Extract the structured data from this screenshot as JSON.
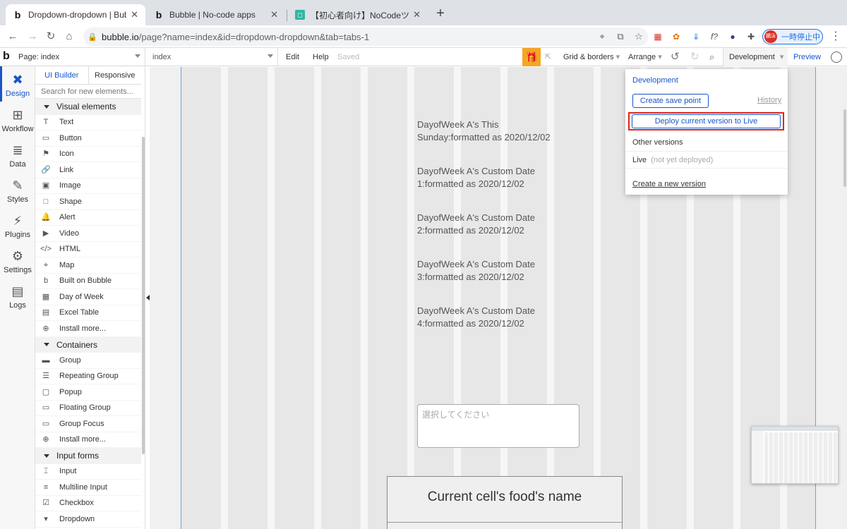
{
  "browser": {
    "tabs": [
      {
        "title": "Dropdown-dropdown | Bubble",
        "favicon": "b",
        "active": true
      },
      {
        "title": "Bubble | No-code apps",
        "favicon": "b",
        "active": false
      },
      {
        "title": "【初心者向け】NoCodeツールBu",
        "favicon": "teal-square",
        "active": false
      }
    ],
    "new_tab": "+",
    "close_glyph": "✕",
    "url_domain": "bubble.io",
    "url_path": "/page?name=index&id=dropdown-dropdown&tab=tabs-1",
    "pause_label": "一時停止中",
    "avatar_text": "鵬泳"
  },
  "topbar": {
    "logo": "b",
    "page_label": "Page: index",
    "element_selector": "index",
    "edit": "Edit",
    "help": "Help",
    "saved": "Saved",
    "grid_borders": "Grid & borders",
    "arrange": "Arrange",
    "environment": "Development",
    "preview": "Preview"
  },
  "rail": [
    {
      "label": "Design",
      "icon": "design-icon",
      "active": true
    },
    {
      "label": "Workflow",
      "icon": "workflow-icon"
    },
    {
      "label": "Data",
      "icon": "database-icon"
    },
    {
      "label": "Styles",
      "icon": "brush-icon"
    },
    {
      "label": "Plugins",
      "icon": "plug-icon"
    },
    {
      "label": "Settings",
      "icon": "gear-icon"
    },
    {
      "label": "Logs",
      "icon": "document-icon"
    }
  ],
  "palette": {
    "tabs": [
      "UI Builder",
      "Responsive"
    ],
    "search_placeholder": "Search for new elements...",
    "sections": [
      {
        "title": "Visual elements",
        "items": [
          {
            "label": "Text",
            "icon": "T"
          },
          {
            "label": "Button",
            "icon": "▭"
          },
          {
            "label": "Icon",
            "icon": "⚑"
          },
          {
            "label": "Link",
            "icon": "🔗"
          },
          {
            "label": "Image",
            "icon": "▣"
          },
          {
            "label": "Shape",
            "icon": "□"
          },
          {
            "label": "Alert",
            "icon": "🔔"
          },
          {
            "label": "Video",
            "icon": "▶"
          },
          {
            "label": "HTML",
            "icon": "</>"
          },
          {
            "label": "Map",
            "icon": "⌖"
          },
          {
            "label": "Built on Bubble",
            "icon": "b"
          },
          {
            "label": "Day of Week",
            "icon": "▦"
          },
          {
            "label": "Excel Table",
            "icon": "▤"
          },
          {
            "label": "Install more...",
            "icon": "⊕"
          }
        ]
      },
      {
        "title": "Containers",
        "items": [
          {
            "label": "Group",
            "icon": "▬"
          },
          {
            "label": "Repeating Group",
            "icon": "☰"
          },
          {
            "label": "Popup",
            "icon": "▢"
          },
          {
            "label": "Floating Group",
            "icon": "▭"
          },
          {
            "label": "Group Focus",
            "icon": "▭"
          },
          {
            "label": "Install more...",
            "icon": "⊕"
          }
        ]
      },
      {
        "title": "Input forms",
        "items": [
          {
            "label": "Input",
            "icon": "⌶"
          },
          {
            "label": "Multiline Input",
            "icon": "≡"
          },
          {
            "label": "Checkbox",
            "icon": "☑"
          },
          {
            "label": "Dropdown",
            "icon": "▾"
          }
        ]
      }
    ]
  },
  "canvas": {
    "texts": [
      "DayofWeek A's This Sunday:formatted as 2020/12/02",
      "DayofWeek A's Custom Date 1:formatted as 2020/12/02",
      "DayofWeek A's Custom Date 2:formatted as 2020/12/02",
      "DayofWeek A's Custom Date 3:formatted as 2020/12/02",
      "DayofWeek A's Custom Date 4:formatted as 2020/12/02"
    ],
    "dropdown_placeholder": "選択してください",
    "repeating_group_text": "Current cell's food's name"
  },
  "dev_panel": {
    "title": "Development",
    "create_save_point": "Create save point",
    "history": "History",
    "deploy": "Deploy current version to Live",
    "other_versions": "Other versions",
    "live_label": "Live",
    "live_status": "(not yet deployed)",
    "create_new_version": "Create a new version"
  },
  "colors": {
    "accent": "#1a55c9",
    "highlight": "#e0261b",
    "gift": "#f5a623"
  }
}
